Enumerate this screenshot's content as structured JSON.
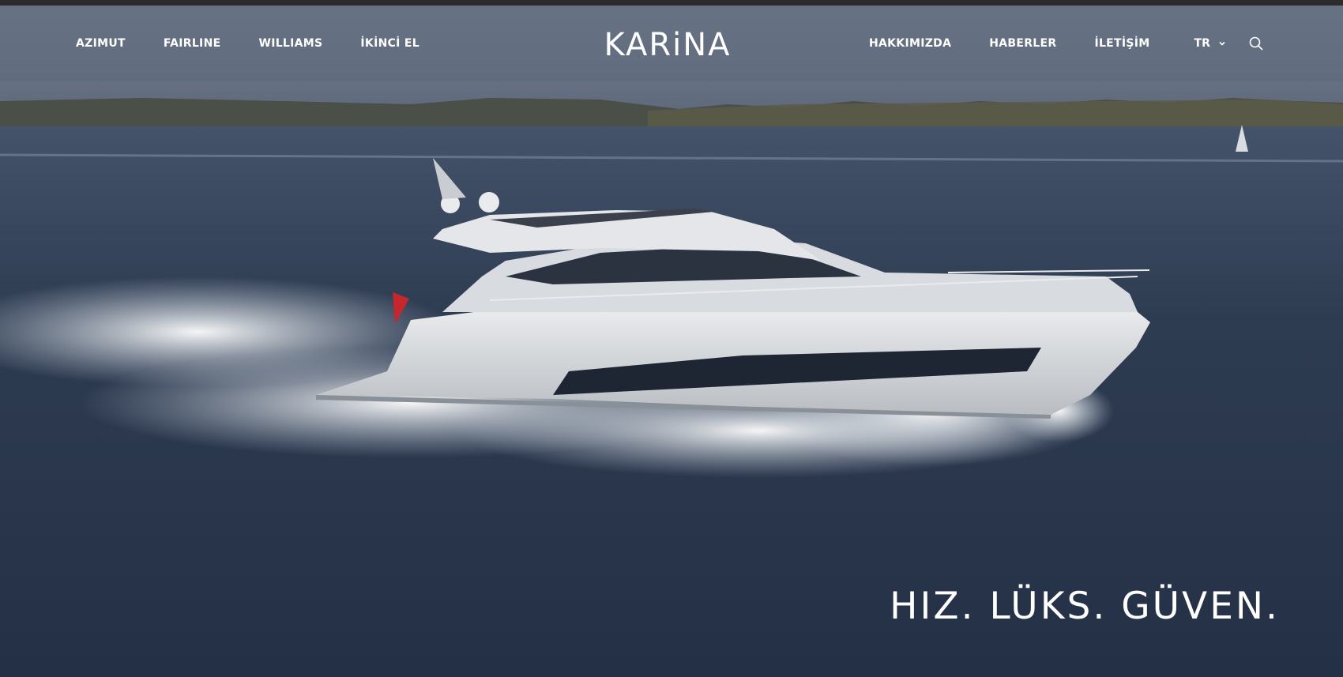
{
  "header": {
    "logo_text": "KARiNA",
    "nav_left": [
      "AZIMUT",
      "FAIRLINE",
      "WILLIAMS",
      "İKİNCİ EL"
    ],
    "nav_right": [
      "HAKKIMIZDA",
      "HABERLER",
      "İLETİŞİM"
    ],
    "language": "TR",
    "icons": {
      "language_dropdown": "chevron-down-icon",
      "search": "search-icon"
    }
  },
  "hero": {
    "tagline": "HIZ. LÜKS. GÜVEN.",
    "image_subject": "yacht-cruising-hero-image"
  },
  "colors": {
    "header_overlay": "#5f6b7d",
    "sea": "#2e3b50",
    "text": "#ffffff"
  }
}
